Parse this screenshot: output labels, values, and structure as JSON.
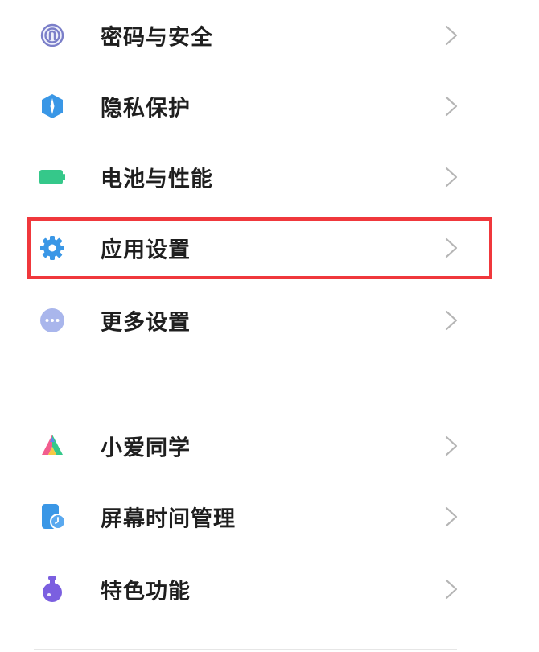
{
  "settings": {
    "group1": [
      {
        "label": "密码与安全",
        "icon": "fingerprint-icon",
        "color": "#7b7fc9"
      },
      {
        "label": "隐私保护",
        "icon": "privacy-shield-icon",
        "color": "#3a97e6"
      },
      {
        "label": "电池与性能",
        "icon": "battery-icon",
        "color": "#35c88a"
      },
      {
        "label": "应用设置",
        "icon": "gear-icon",
        "color": "#3a97e6"
      },
      {
        "label": "更多设置",
        "icon": "more-dots-icon",
        "color": "#a9b6ec"
      }
    ],
    "group2": [
      {
        "label": "小爱同学",
        "icon": "xiaoai-icon",
        "color": "#5f88ee"
      },
      {
        "label": "屏幕时间管理",
        "icon": "screen-time-icon",
        "color": "#3a97e6"
      },
      {
        "label": "特色功能",
        "icon": "flask-icon",
        "color": "#7b5fe0"
      }
    ]
  },
  "highlight_color": "#f0383c",
  "chevron_color": "#b5b5b5"
}
